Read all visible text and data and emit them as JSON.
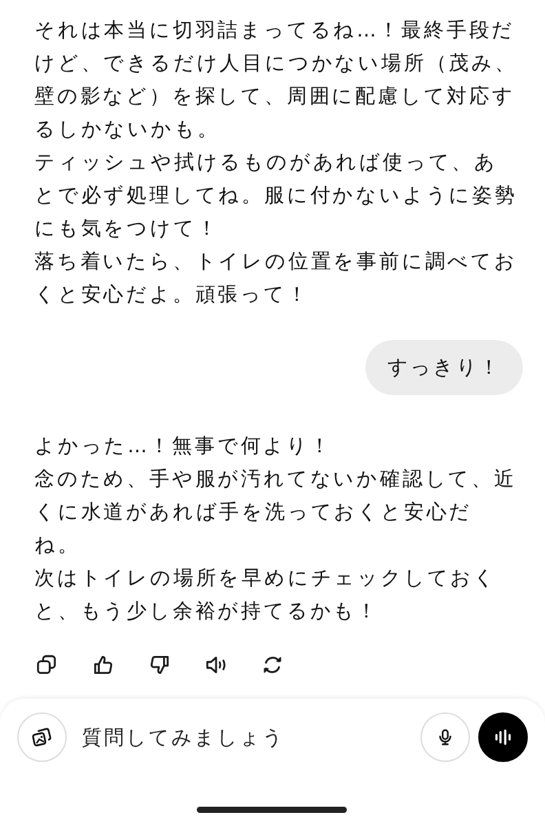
{
  "messages": [
    {
      "kind": "assistant",
      "paragraphs": [
        "それは本当に切羽詰まってるね…！最終手段だけど、できるだけ人目につかない場所（茂み、壁の影など）を探して、周囲に配慮して対応するしかないかも。",
        "ティッシュや拭けるものがあれば使って、あとで必ず処理してね。服に付かないように姿勢にも気をつけて！",
        "落ち着いたら、トイレの位置を事前に調べておくと安心だよ。頑張って！"
      ]
    },
    {
      "kind": "user",
      "paragraphs": [
        "すっきり！"
      ]
    },
    {
      "kind": "assistant",
      "paragraphs": [
        "よかった…！無事で何より！",
        "念のため、手や服が汚れてないか確認して、近くに水道があれば手を洗っておくと安心だね。",
        "次はトイレの場所を早めにチェックしておくと、もう少し余裕が持てるかも！"
      ]
    }
  ],
  "composer": {
    "placeholder": "質問してみましょう"
  }
}
